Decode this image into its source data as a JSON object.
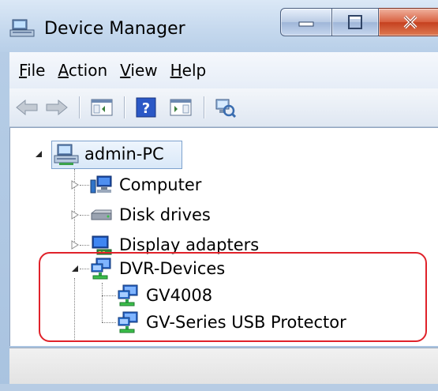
{
  "window": {
    "title": "Device Manager"
  },
  "menu": [
    {
      "underline": "F",
      "rest": "ile"
    },
    {
      "underline": "A",
      "rest": "ction"
    },
    {
      "underline": "V",
      "rest": "iew"
    },
    {
      "underline": "H",
      "rest": "elp"
    }
  ],
  "toolbar": {
    "icons": [
      "back-arrow-icon",
      "forward-arrow-icon",
      "console-tree-icon",
      "help-icon",
      "action-pane-icon",
      "scan-hardware-icon"
    ]
  },
  "tree": {
    "root": "admin-PC",
    "categories": [
      {
        "label": "Computer",
        "icon": "computer-icon",
        "expanded": false
      },
      {
        "label": "Disk drives",
        "icon": "disk-drive-icon",
        "expanded": false
      },
      {
        "label": "Display adapters",
        "icon": "display-adapter-icon",
        "expanded": false
      },
      {
        "label": "DVR-Devices",
        "icon": "network-device-icon",
        "expanded": true
      }
    ],
    "dvr_children": [
      "GV4008",
      "GV-Series USB Protector"
    ]
  },
  "colors": {
    "highlight_border": "#e0222a",
    "close_button": "#c5401f",
    "title_bar": "#c6d9ee"
  }
}
